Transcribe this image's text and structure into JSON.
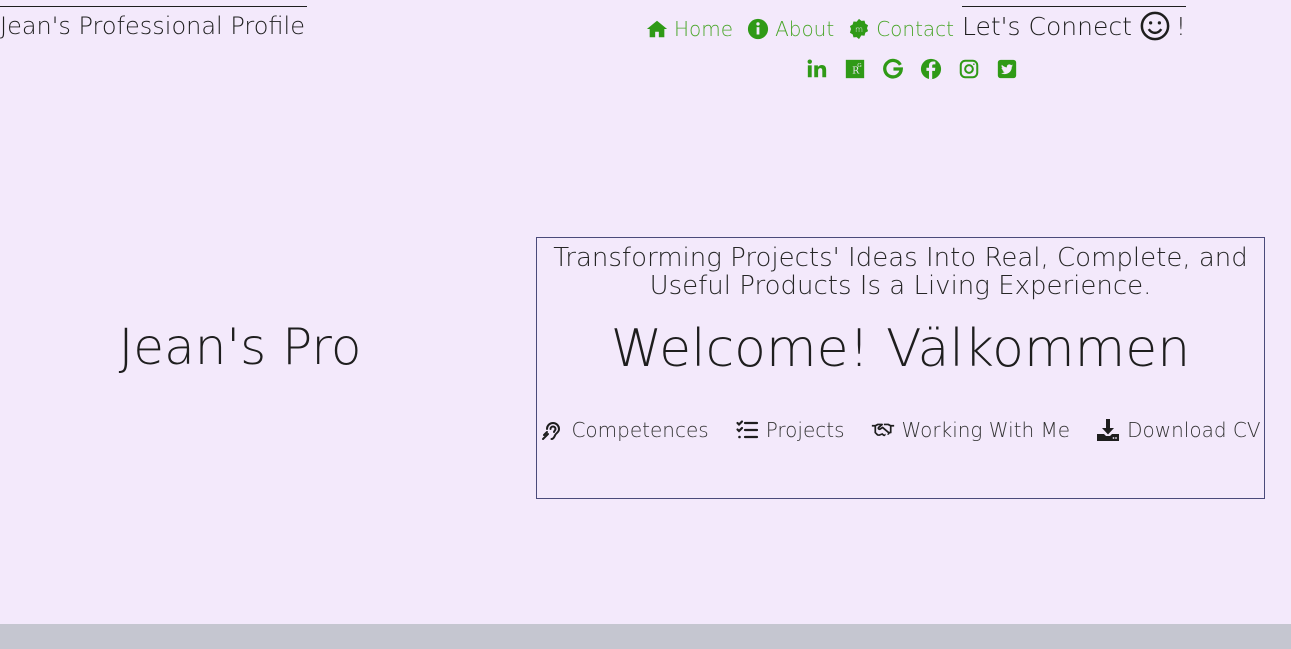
{
  "header": {
    "brand": "Jean's Professional Profile",
    "nav": [
      {
        "label": "Home",
        "icon": "home-icon"
      },
      {
        "label": "About",
        "icon": "info-icon"
      },
      {
        "label": "Contact",
        "icon": "contact-badge-icon"
      }
    ],
    "connect": {
      "label": "Let's Connect",
      "suffix": "!",
      "icon": "smile-icon"
    },
    "socials": [
      "linkedin-icon",
      "researchgate-icon",
      "google-icon",
      "facebook-icon",
      "instagram-icon",
      "twitter-icon"
    ]
  },
  "hero": {
    "left_title": "Jean's Pro",
    "tagline": "Transforming Projects' Ideas Into Real, Complete, and Useful Products Is a Living Experience.",
    "welcome": "Welcome! Välkommen",
    "actions": [
      {
        "label": "Competences",
        "icon": "ear-icon"
      },
      {
        "label": "Projects",
        "icon": "checklist-icon"
      },
      {
        "label": "Working With Me",
        "icon": "handshake-icon"
      },
      {
        "label": "Download CV",
        "icon": "download-icon"
      }
    ]
  },
  "colors": {
    "background": "#f3e9fb",
    "accent_green": "#2f9a16",
    "footer": "#c5c6d0",
    "box_border": "#4a4a7a"
  }
}
